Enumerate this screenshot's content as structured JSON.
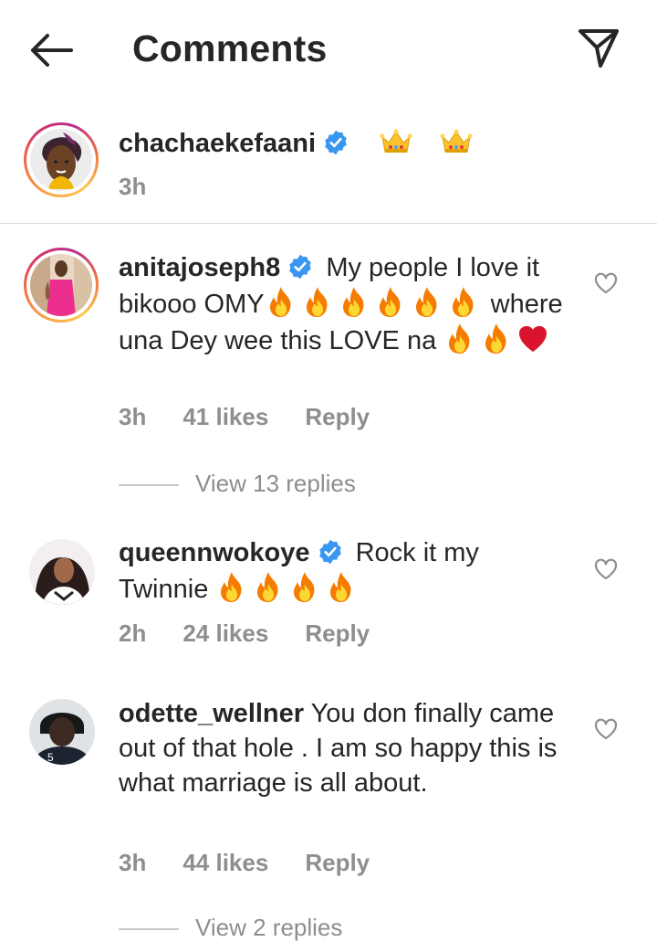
{
  "header": {
    "title": "Comments",
    "back_icon": "back-arrow-icon",
    "share_icon": "send-icon"
  },
  "caption": {
    "username": "chachaekefaani",
    "emojis": [
      "crown",
      "crown"
    ],
    "time": "3h"
  },
  "comments": [
    {
      "username": "anitajoseph8",
      "verified": true,
      "text_1": "My people I love it bikooo OMY",
      "text_2": "where una Dey wee this LOVE na",
      "time": "3h",
      "likes": "41 likes",
      "reply": "Reply",
      "view_replies": "View 13 replies"
    },
    {
      "username": "queennwokoye",
      "verified": true,
      "text_1": "Rock it my Twinnie",
      "time": "2h",
      "likes": "24 likes",
      "reply": "Reply"
    },
    {
      "username": "odette_wellner",
      "verified": false,
      "text_1": "You don finally came out of that hole . I am so happy this is what marriage is all about.",
      "time": "3h",
      "likes": "44 likes",
      "reply": "Reply",
      "view_replies": "View 2 replies"
    }
  ],
  "colors": {
    "text": "#262626",
    "muted": "#8e8e8e",
    "verified": "#3897f0",
    "heart_stroke": "#8e8e8e"
  }
}
